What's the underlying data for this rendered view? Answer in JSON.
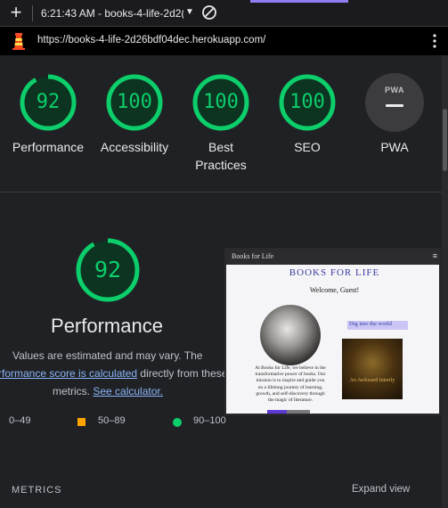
{
  "browser": {
    "time_tab": "6:21:43 AM - books-4-life-2d2(",
    "url": "https://books-4-life-2d26bdf04dec.herokuapp.com/"
  },
  "categories": [
    {
      "label": "Performance",
      "score": "92",
      "value": 92
    },
    {
      "label": "Accessibility",
      "score": "100",
      "value": 100
    },
    {
      "label": "Best",
      "label2": "Practices",
      "score": "100",
      "value": 100
    },
    {
      "label": "SEO",
      "score": "100",
      "value": 100
    },
    {
      "label": "PWA",
      "badge": "PWA"
    }
  ],
  "performance": {
    "score": "92",
    "value": 92,
    "title": "Performance",
    "desc_1": "Values are estimated and may vary. The",
    "desc_link": "rformance score is calculated",
    "desc_2": " directly from these",
    "desc_3": "metrics. ",
    "calc_link": "See calculator."
  },
  "legend": {
    "low": "0–49",
    "mid": "50–89",
    "high": "90–100"
  },
  "footer": {
    "metrics": "METRICS",
    "expand": "Expand view"
  },
  "thumbnail": {
    "nav_title": "Books for Life",
    "nav_menu": "≡",
    "brand": "BOOKS FOR LIFE",
    "welcome": "Welcome, Guest!",
    "body": "At Books for Life, we believe in the transformative power of books. Our mission is to inspire and guide you on a lifelong journey of learning, growth, and self-discovery through the magic of literature.",
    "dig": "Dig into the world",
    "book_title": "An Awkward Intertly"
  },
  "colors": {
    "pass": "#0cce6b",
    "average": "#ffa400",
    "fail": "#ff4e42",
    "link": "#8ab4f8"
  }
}
